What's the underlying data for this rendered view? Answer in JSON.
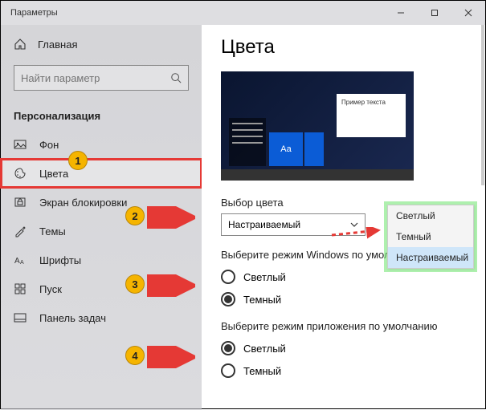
{
  "window": {
    "title": "Параметры"
  },
  "sidebar": {
    "home": "Главная",
    "search_placeholder": "Найти параметр",
    "section": "Персонализация",
    "items": [
      {
        "label": "Фон"
      },
      {
        "label": "Цвета"
      },
      {
        "label": "Экран блокировки"
      },
      {
        "label": "Темы"
      },
      {
        "label": "Шрифты"
      },
      {
        "label": "Пуск"
      },
      {
        "label": "Панель задач"
      }
    ]
  },
  "content": {
    "title": "Цвета",
    "preview_text": "Пример текста",
    "preview_tile": "Aa",
    "choose_color_label": "Выбор цвета",
    "dropdown_value": "Настраиваемый",
    "dropdown_options": [
      "Светлый",
      "Темный",
      "Настраиваемый"
    ],
    "windows_mode_label": "Выберите режим Windows по умолчанию",
    "windows_mode_options": {
      "light": "Светлый",
      "dark": "Темный"
    },
    "app_mode_label": "Выберите режим приложения по умолчанию",
    "app_mode_options": {
      "light": "Светлый",
      "dark": "Темный"
    }
  },
  "annotations": {
    "b1": "1",
    "b2": "2",
    "b3": "3",
    "b4": "4"
  }
}
